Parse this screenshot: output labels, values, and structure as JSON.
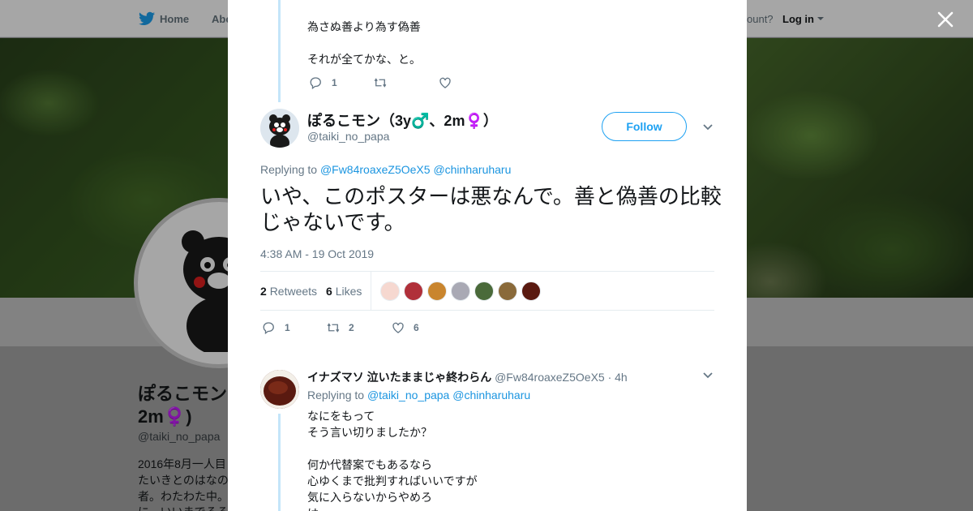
{
  "background": {
    "nav": {
      "home": "Home",
      "about": "Abo",
      "account": "ccount?",
      "login": "Log in"
    },
    "profile": {
      "name_line1": "ぽるこモン",
      "name_line2": "2m♀️)",
      "handle": "@taiki_no_papa",
      "bio": [
        "2016年8月一人目",
        "たいきとのはなの",
        "者。わたわた中。",
        "に、いいまでるる"
      ]
    }
  },
  "modal": {
    "previous_tweet": {
      "lines": [
        "為さぬ善より為す偽善",
        "それが全てかな、と。"
      ],
      "reply_count": "1"
    },
    "main_tweet": {
      "name": "ぽるこモン（3y♂️、2m♀️）",
      "handle": "@taiki_no_papa",
      "follow_label": "Follow",
      "replying_prefix": "Replying to",
      "replying_to": [
        "@Fw84roaxeZ5OeX5",
        "@chinharuharu"
      ],
      "text": "いや、このポスターは悪なんで。善と偽善の比較じゃないです。",
      "timestamp": "4:38 AM - 19 Oct 2019",
      "retweets_count": "2",
      "retweets_label": "Retweets",
      "likes_count": "6",
      "likes_label": "Likes",
      "likers_colors": [
        "#f6d8d0",
        "#b0303a",
        "#c9852e",
        "#a9a9b4",
        "#4a6a3a",
        "#8a6a3a",
        "#5a1a10"
      ],
      "reply_count": "1",
      "retweet_count_action": "2",
      "like_count_action": "6"
    },
    "reply_tweet": {
      "name": "イナズマソ 泣いたままじゃ終わらん",
      "handle": "@Fw84roaxeZ5OeX5",
      "time": "· 4h",
      "replying_prefix": "Replying to",
      "replying_to": [
        "@taiki_no_papa",
        "@chinharuharu"
      ],
      "lines": [
        "なにをもって",
        "そう言い切りましたか？",
        "",
        "何か代替案でもあるなら",
        "心ゆくまで批判すればいいですが",
        "気に入らないからやめろ",
        "は"
      ]
    }
  },
  "colors": {
    "accent": "#1da1f2",
    "link": "#1b95e0",
    "muted": "#657786",
    "thread": "#c4e5f9"
  }
}
